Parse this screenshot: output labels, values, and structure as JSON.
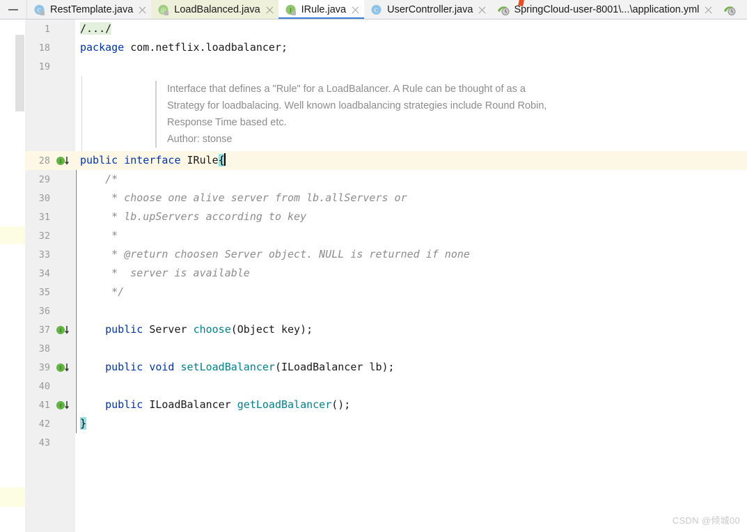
{
  "window": {
    "collapse_icon": "minus-icon"
  },
  "tabs": [
    {
      "label": "RestTemplate.java",
      "icon": "java-class-icon",
      "state": "plain",
      "close_icon": "close-icon"
    },
    {
      "label": "LoadBalanced.java",
      "icon": "java-annotation-icon",
      "state": "cream",
      "close_icon": "close-icon"
    },
    {
      "label": "IRule.java",
      "icon": "java-interface-icon",
      "state": "active",
      "close_icon": "close-icon"
    },
    {
      "label": "UserController.java",
      "icon": "java-class-icon",
      "state": "plain",
      "close_icon": "close-icon"
    },
    {
      "label": "SpringCloud-user-8001\\...\\application.yml",
      "icon": "spring-yml-icon",
      "state": "plain",
      "close_icon": "close-icon"
    },
    {
      "label": "",
      "icon": "spring-yml-icon",
      "state": "plain",
      "close_icon": ""
    }
  ],
  "annotation": {
    "shape": "orange-arc",
    "color": "#ee4b1f"
  },
  "gutter": {
    "rows": [
      {
        "num": "1",
        "impl": false,
        "current": false
      },
      {
        "num": "18",
        "impl": false,
        "current": false
      },
      {
        "num": "19",
        "impl": false,
        "current": false
      },
      {
        "num": "",
        "impl": false,
        "current": false
      },
      {
        "num": "",
        "impl": false,
        "current": false
      },
      {
        "num": "",
        "impl": false,
        "current": false
      },
      {
        "num": "",
        "impl": false,
        "current": false
      },
      {
        "num": "28",
        "impl": true,
        "current": true
      },
      {
        "num": "29",
        "impl": false,
        "current": false
      },
      {
        "num": "30",
        "impl": false,
        "current": false
      },
      {
        "num": "31",
        "impl": false,
        "current": false
      },
      {
        "num": "32",
        "impl": false,
        "current": false
      },
      {
        "num": "33",
        "impl": false,
        "current": false
      },
      {
        "num": "34",
        "impl": false,
        "current": false
      },
      {
        "num": "35",
        "impl": false,
        "current": false
      },
      {
        "num": "36",
        "impl": false,
        "current": false
      },
      {
        "num": "37",
        "impl": true,
        "current": false
      },
      {
        "num": "38",
        "impl": false,
        "current": false
      },
      {
        "num": "39",
        "impl": true,
        "current": false
      },
      {
        "num": "40",
        "impl": false,
        "current": false
      },
      {
        "num": "41",
        "impl": true,
        "current": false
      },
      {
        "num": "42",
        "impl": false,
        "current": false
      },
      {
        "num": "43",
        "impl": false,
        "current": false
      }
    ]
  },
  "code": {
    "folded_region": "/.../",
    "lines": {
      "package_kw": "package",
      "package_name": " com.netflix.loadbalancer;",
      "decl_public": "public",
      "decl_interface": "interface",
      "decl_name": "IRule",
      "decl_brace": "{",
      "c_open": "    /*",
      "c1": "     * choose one alive server from lb.allServers or",
      "c2": "     * lb.upServers according to key",
      "c3": "     *",
      "c4": "     * @return choosen Server object. NULL is returned if none",
      "c5": "     *  server is available",
      "c_close": "     */",
      "m1_indent": "    ",
      "m1_public": "public",
      "m1_type": " Server ",
      "m1_name": "choose",
      "m1_args": "(Object key);",
      "m2_public": "public",
      "m2_void": " void ",
      "m2_name": "setLoadBalancer",
      "m2_args": "(ILoadBalancer lb);",
      "m3_public": "public",
      "m3_type": " ILoadBalancer ",
      "m3_name": "getLoadBalancer",
      "m3_args": "();",
      "close_brace": "}"
    }
  },
  "javadoc": {
    "paragraphs": [
      "Interface that defines a \"Rule\" for a LoadBalancer. A Rule can be thought of as a",
      "Strategy for loadbalacing. Well known loadbalancing strategies include Round Robin,",
      "Response Time based etc.",
      "Author: stonse"
    ]
  },
  "watermark": {
    "text": "CSDN @倾城00"
  },
  "colors": {
    "keyword": "#0033b3",
    "method": "#00828c",
    "comment": "#8c8c8c",
    "folded_bg": "#e3f0dc",
    "brace_highlight": "#93e0e3",
    "current_line_bg": "#fdf8e6",
    "active_tab_underline": "#3b7ddd",
    "annotation": "#ee4b1f"
  }
}
